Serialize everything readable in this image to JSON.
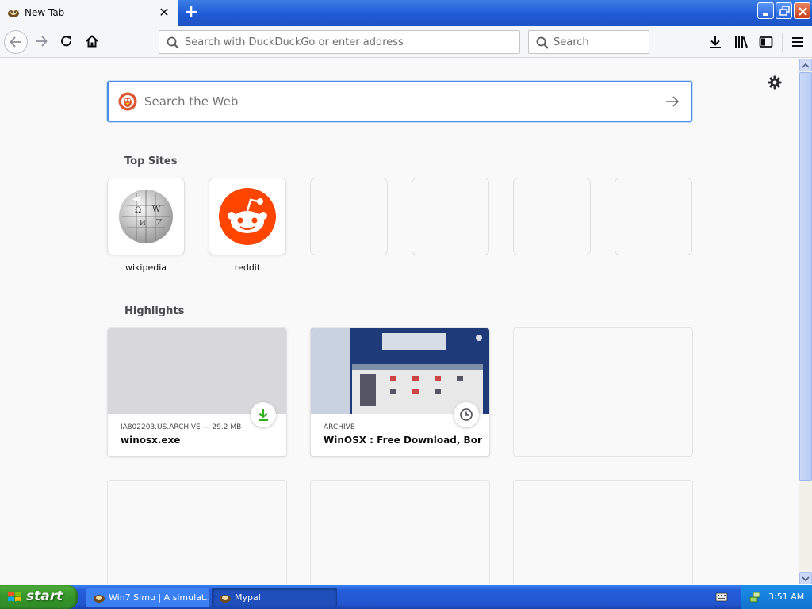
{
  "browser": {
    "tab": {
      "title": "New Tab"
    },
    "urlbar": {
      "placeholder": "Search with DuckDuckGo or enter address"
    },
    "searchbar": {
      "placeholder": "Search"
    }
  },
  "newtab": {
    "search": {
      "placeholder": "Search the Web"
    },
    "top_sites": {
      "title": "Top Sites",
      "items": [
        {
          "label": "wikipedia",
          "icon": "wikipedia-globe-icon"
        },
        {
          "label": "reddit",
          "icon": "reddit-alien-icon"
        },
        {
          "label": ""
        },
        {
          "label": ""
        },
        {
          "label": ""
        },
        {
          "label": ""
        }
      ]
    },
    "highlights": {
      "title": "Highlights",
      "items": [
        {
          "source": "IA802203.US.ARCHIVE — 29.2 MB",
          "title": "winosx.exe",
          "badge": "download-icon"
        },
        {
          "source": "ARCHIVE",
          "title": "WinOSX : Free Download, Borro…",
          "badge": "clock-icon"
        }
      ]
    }
  },
  "taskbar": {
    "start_label": "start",
    "tasks": [
      {
        "label": "Win7 Simu | A simulat..."
      },
      {
        "label": "Mypal"
      }
    ],
    "clock": "3:51 AM"
  },
  "colors": {
    "accent": "#4a8ee7",
    "reddit": "#ff4500",
    "download_green": "#30b01a"
  }
}
